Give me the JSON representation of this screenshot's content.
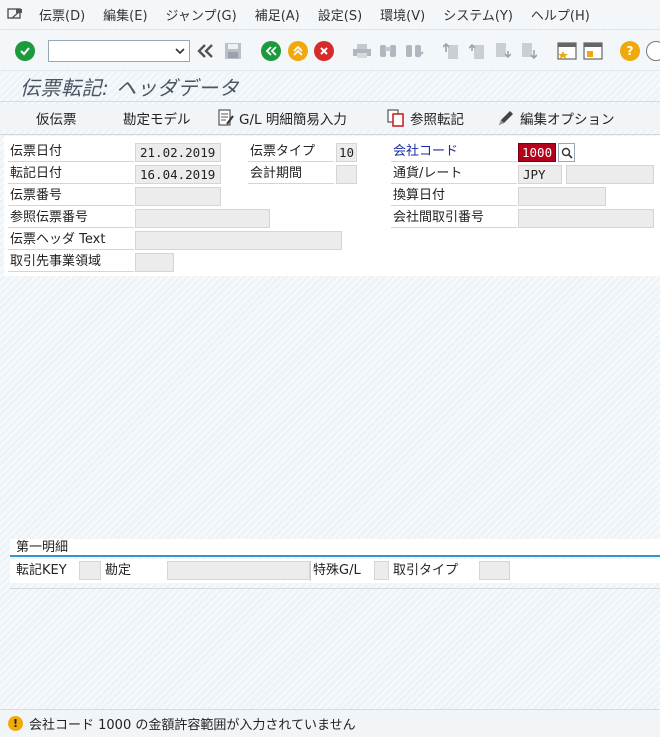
{
  "menu": {
    "items": [
      "伝票(D)",
      "編集(E)",
      "ジャンプ(G)",
      "補足(A)",
      "設定(S)",
      "環境(V)",
      "システム(Y)",
      "ヘルプ(H)"
    ]
  },
  "toolbar": {
    "command_field": "",
    "icons": [
      "check-icon",
      "dropdown-icon",
      "double-left-icon",
      "save-icon",
      "back-icon",
      "exit-icon",
      "cancel-icon",
      "print-icon",
      "find-icon",
      "find-next-icon",
      "first-page-icon",
      "previous-page-icon",
      "next-page-icon",
      "last-page-icon",
      "new-session-icon",
      "shortcut-icon",
      "help-icon"
    ]
  },
  "title": "伝票転記: ヘッダデータ",
  "app_toolbar": {
    "held_document": "仮伝票",
    "account_model": "勘定モデル",
    "gl_fast_entry": "G/L 明細簡易入力",
    "post_with_reference": "参照転記",
    "editing_options": "編集オプション"
  },
  "header": {
    "document_date": {
      "label": "伝票日付",
      "value": "21.02.2019"
    },
    "posting_date": {
      "label": "転記日付",
      "value": "16.04.2019"
    },
    "document_number": {
      "label": "伝票番号",
      "value": ""
    },
    "reference": {
      "label": "参照伝票番号",
      "value": ""
    },
    "header_text": {
      "label": "伝票ヘッダ Text",
      "value": ""
    },
    "trading_part_ba": {
      "label": "取引先事業領域",
      "value": ""
    },
    "document_type": {
      "label": "伝票タイプ",
      "value": "10"
    },
    "period": {
      "label": "会計期間",
      "value": ""
    },
    "company_code": {
      "label": "会社コード",
      "value": "1000"
    },
    "currency_rate": {
      "label": "通貨/レート",
      "currency": "JPY",
      "rate": ""
    },
    "translation_date": {
      "label": "換算日付",
      "value": ""
    },
    "cross_cc_number": {
      "label": "会社間取引番号",
      "value": ""
    }
  },
  "first_item": {
    "title": "第一明細",
    "posting_key": {
      "label": "転記KEY",
      "value": ""
    },
    "account": {
      "label": "勘定",
      "value": ""
    },
    "special_gl": {
      "label": "特殊G/L",
      "value": ""
    },
    "transaction_type": {
      "label": "取引タイプ",
      "value": ""
    }
  },
  "status": {
    "type": "warning",
    "message": "会社コード 1000 の金額許容範囲が入力されていません"
  },
  "colors": {
    "accent_blue": "#2f98c9",
    "link_blue": "#1a2aa8",
    "required_field": "#b3001b",
    "confirm_green": "#1d9a3c",
    "exit_orange": "#f0a90c",
    "cancel_red": "#d62b2b"
  }
}
